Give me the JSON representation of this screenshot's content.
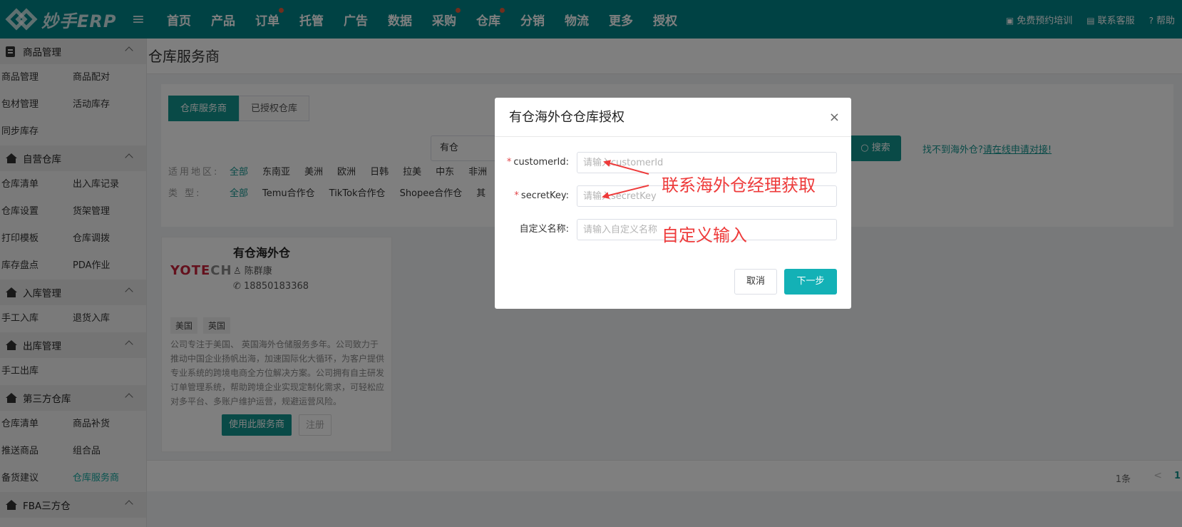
{
  "app": {
    "logo_text": "妙手ERP",
    "menu_icon": "hamburger-icon"
  },
  "nav": [
    {
      "label": "首页",
      "dot": false
    },
    {
      "label": "产品",
      "dot": false
    },
    {
      "label": "订单",
      "dot": true
    },
    {
      "label": "托管",
      "dot": false
    },
    {
      "label": "广告",
      "dot": false
    },
    {
      "label": "数据",
      "dot": false
    },
    {
      "label": "采购",
      "dot": true
    },
    {
      "label": "仓库",
      "dot": true
    },
    {
      "label": "分销",
      "dot": false
    },
    {
      "label": "物流",
      "dot": false
    },
    {
      "label": "更多",
      "dot": false
    },
    {
      "label": "授权",
      "dot": false
    }
  ],
  "top_right": {
    "training": "免费预约培训",
    "support": "联系客服",
    "help": "帮助"
  },
  "sidebar": {
    "sections": [
      {
        "title": "商品管理",
        "icon": "clipboard-icon",
        "items": [
          "商品管理",
          "商品配对",
          "包材管理",
          "活动库存",
          "同步库存"
        ]
      },
      {
        "title": "自营仓库",
        "icon": "warehouse-icon",
        "items": [
          "仓库清单",
          "出入库记录",
          "仓库设置",
          "货架管理",
          "打印模板",
          "仓库调拨",
          "库存盘点",
          "PDA作业"
        ]
      },
      {
        "title": "入库管理",
        "icon": "warehouse-icon",
        "items": [
          "手工入库",
          "退货入库"
        ]
      },
      {
        "title": "出库管理",
        "icon": "warehouse-icon",
        "items": [
          "手工出库"
        ]
      },
      {
        "title": "第三方仓库",
        "icon": "warehouse-icon",
        "items": [
          "仓库清单",
          "商品补货",
          "推送商品",
          "组合品",
          "备货建议",
          "仓库服务商"
        ]
      },
      {
        "title": "FBA三方仓",
        "icon": "warehouse-icon",
        "items": []
      }
    ],
    "active_item": "仓库服务商"
  },
  "page": {
    "title": "仓库服务商",
    "tabs": [
      "仓库服务商",
      "已授权仓库"
    ],
    "search_value": "有仓",
    "search_button": "搜索",
    "not_found_prefix": "找不到海外仓?",
    "not_found_link": "请在线申请对接!",
    "filters": [
      {
        "label": "适用地区:",
        "options": [
          "全部",
          "东南亚",
          "美洲",
          "欧洲",
          "日韩",
          "拉美",
          "中东",
          "非洲"
        ]
      },
      {
        "label": "类    型:",
        "options": [
          "全部",
          "Temu合作仓",
          "TikTok合作仓",
          "Shopee合作仓",
          "其"
        ]
      }
    ]
  },
  "card": {
    "logo_red": "YOTE",
    "logo_gray": "CH",
    "name": "有仓海外仓",
    "contact": "陈群康",
    "phone": "18850183368",
    "tags": [
      "美国",
      "英国"
    ],
    "description": "公司专注于美国、 英国海外仓储服务多年。公司致力于推动中国企业扬帆出海，加速国际化大循环，为客户提供专业系统的跨境电商全方位解决方案。公司拥有自主研发订单管理系统，帮助跨境企业实现定制化需求，可轻松应对多平台、多账户维护运营，规避运营风险。",
    "use_button": "使用此服务商",
    "register_button": "注册"
  },
  "pagination": {
    "count": "1条",
    "prev": "<",
    "page": "1"
  },
  "dialog": {
    "title": "有仓海外仓仓库授权",
    "close": "×",
    "fields": [
      {
        "label": "customerId:",
        "required": true,
        "placeholder": "请输入customerId",
        "value": ""
      },
      {
        "label": "secretKey:",
        "required": true,
        "placeholder": "请输入secretKey",
        "value": ""
      },
      {
        "label": "自定义名称:",
        "required": false,
        "placeholder": "请输入自定义名称",
        "value": ""
      }
    ],
    "required_mark": "*",
    "cancel": "取消",
    "next": "下一步"
  },
  "annotations": {
    "credentials_note": "联系海外仓经理获取",
    "custom_name_note": "自定义输入",
    "color": "#ee3b3b"
  },
  "colors": {
    "brand": "#008489",
    "accent": "#12958f",
    "next_button": "#13b1b6"
  }
}
